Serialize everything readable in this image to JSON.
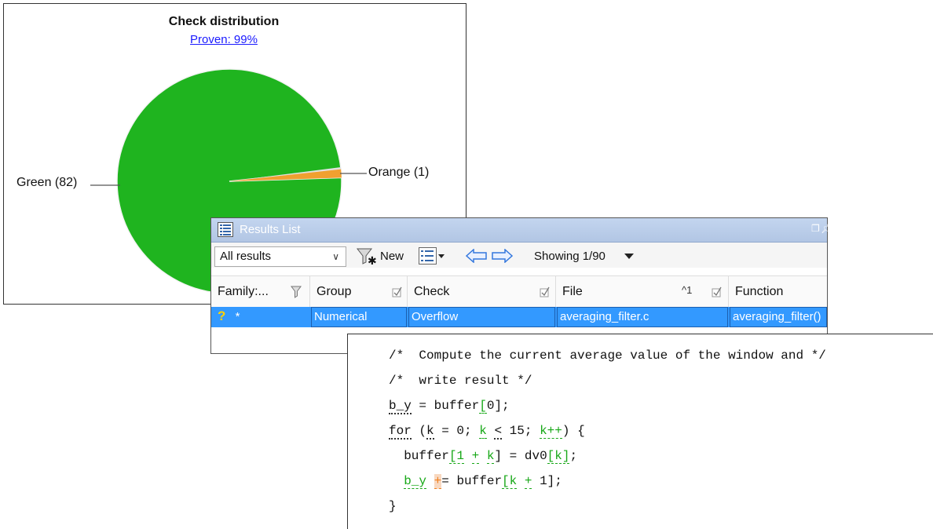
{
  "distribution": {
    "title": "Check distribution",
    "proven_link": "Proven: 99%",
    "green_label": "Green (82)",
    "orange_label": "Orange (1)",
    "colors": {
      "green": "#1fb41f",
      "orange": "#f0a030",
      "gray": "#e0e0e0"
    }
  },
  "chart_data": {
    "type": "pie",
    "title": "Check distribution",
    "subtitle": "Proven: 99%",
    "categories": [
      "Green",
      "Orange"
    ],
    "values": [
      82,
      1
    ],
    "labels": [
      "Green (82)",
      "Orange (1)"
    ],
    "colors": [
      "#1fb41f",
      "#f0a030"
    ]
  },
  "results_list": {
    "title": "Results List",
    "filter_value": "All results",
    "new_label": "New",
    "showing": "Showing 1/90",
    "columns": [
      "Family:...",
      "Group",
      "Check",
      "File",
      "Function"
    ],
    "sort_indicator": "^1",
    "row": {
      "family_icon": "?",
      "family_star": "*",
      "group": "Numerical",
      "check": "Overflow",
      "file": "averaging_filter.c",
      "function": "averaging_filter()"
    }
  },
  "code": {
    "line1": "/*  Compute the current average value of the window and */",
    "line2": "/*  write result */",
    "line3_a": "b_y",
    "line3_b": " = buffer",
    "line3_c": "[",
    "line3_d": "0];",
    "line4_a": "for",
    "line4_b": " (",
    "line4_c": "k",
    "line4_d": " = 0; ",
    "line4_e": "k",
    "line4_f": " ",
    "line4_g": "<",
    "line4_h": " 15; ",
    "line4_i": "k++",
    "line4_j": ") {",
    "line5_a": "  buffer",
    "line5_b": "[1",
    "line5_c": " ",
    "line5_d": "+",
    "line5_e": " ",
    "line5_f": "k",
    "line5_g": "] = dv0",
    "line5_h": "[k]",
    "line5_i": ";",
    "line6_a": "  ",
    "line6_b": "b_y",
    "line6_c": " ",
    "line6_d": "+",
    "line6_e": "= buffer",
    "line6_f": "[k",
    "line6_g": " ",
    "line6_h": "+",
    "line6_i": " 1];",
    "line7": "}"
  }
}
